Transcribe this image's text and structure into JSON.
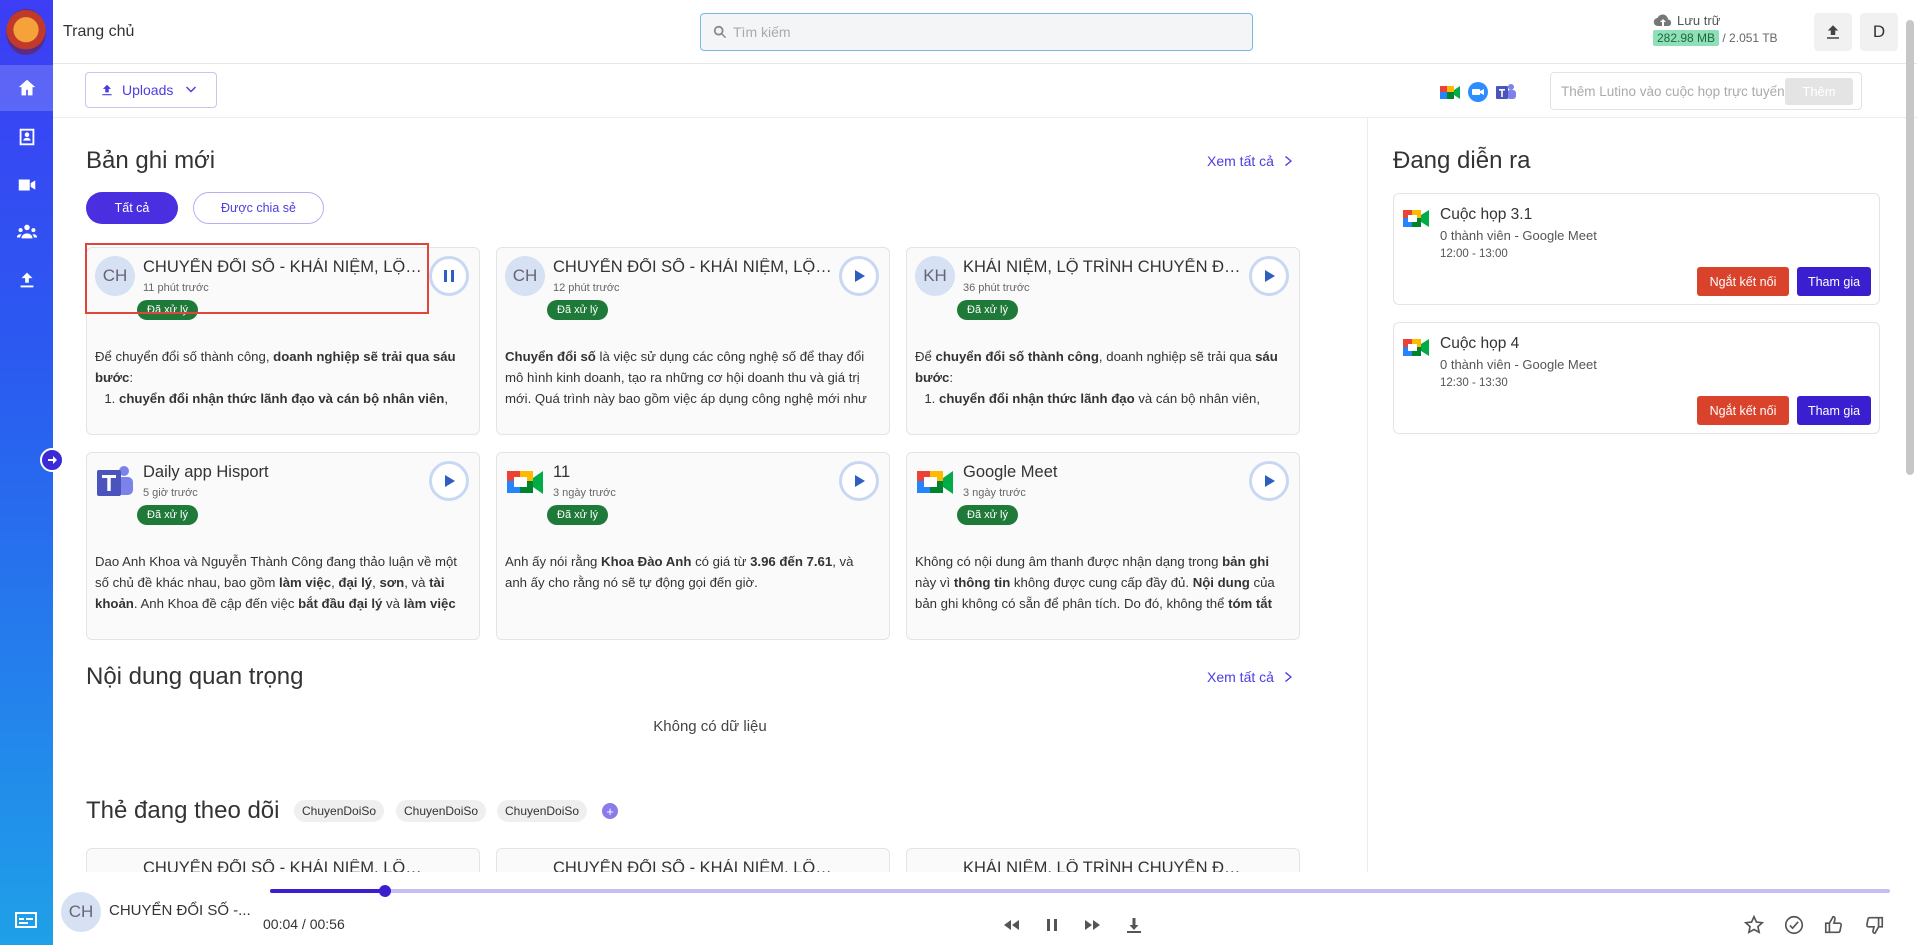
{
  "header": {
    "breadcrumb": "Trang chủ",
    "search_placeholder": "Tìm kiếm",
    "storage_label": "Lưu trữ",
    "storage_used": "282.98 MB",
    "storage_total": "/ 2.051 TB",
    "avatar_letter": "D"
  },
  "toolbar": {
    "uploads_label": "Uploads",
    "invite_placeholder": "Thêm Lutino vào cuộc họp trực tuyến",
    "invite_button": "Thêm"
  },
  "recent": {
    "title": "Bản ghi mới",
    "see_all": "Xem tất cả",
    "filter_all": "Tất cả",
    "filter_shared": "Được chia sẻ",
    "cards": [
      {
        "avatar": "CH",
        "title": "CHUYỂN ĐỔI SỐ - KHÁI NIỆM, LỘ TRÌN...",
        "time": "11 phút trước",
        "status": "Đã xử lý",
        "playing": true
      },
      {
        "avatar": "CH",
        "title": "CHUYỂN ĐỔI SỐ - KHÁI NIỆM, LỘ TRÌN...",
        "time": "12 phút trước",
        "status": "Đã xử lý",
        "playing": false
      },
      {
        "avatar": "KH",
        "title": "KHÁI NIỆM, LỘ TRÌNH CHUYỂN ĐỔI SỐ...",
        "time": "36 phút trước",
        "status": "Đã xử lý",
        "playing": false
      },
      {
        "avatar": "teams",
        "title": "Daily app Hisport",
        "time": "5 giờ trước",
        "status": "Đã xử lý",
        "playing": false
      },
      {
        "avatar": "meet",
        "title": "11",
        "time": "3 ngày trước",
        "status": "Đã xử lý",
        "playing": false
      },
      {
        "avatar": "meet",
        "title": "Google Meet",
        "time": "3 ngày trước",
        "status": "Đã xử lý",
        "playing": false
      }
    ]
  },
  "important": {
    "title": "Nội dung quan trọng",
    "see_all": "Xem tất cả",
    "empty": "Không có dữ liệu"
  },
  "tags": {
    "title": "Thẻ đang theo dõi",
    "items": [
      "ChuyenDoiSo",
      "ChuyenDoiSo",
      "ChuyenDoiSo"
    ],
    "add": "+",
    "peek_titles": [
      "CHUYỂN ĐỔI SỐ - KHÁI NIỆM, LỘ TRÌN...",
      "CHUYỂN ĐỔI SỐ - KHÁI NIỆM, LỘ TRÌN...",
      "KHÁI NIỆM, LỘ TRÌNH CHUYỂN ĐỔI SỐ..."
    ]
  },
  "live": {
    "title": "Đang diễn ra",
    "meetings": [
      {
        "name": "Cuộc họp 3.1",
        "subtitle": "0 thành viên - Google Meet",
        "time": "12:00 - 13:00",
        "disconnect": "Ngắt kết nối",
        "join": "Tham gia"
      },
      {
        "name": "Cuộc họp 4",
        "subtitle": "0 thành viên - Google Meet",
        "time": "12:30 - 13:30",
        "disconnect": "Ngắt kết nối",
        "join": "Tham gia"
      }
    ]
  },
  "player": {
    "avatar": "CH",
    "title": "CHUYỂN ĐỔI SỐ -...",
    "time": "00:04 / 00:56",
    "progress": 0.071
  },
  "colors": {
    "accent": "#3a1fd0",
    "danger": "#d9432c",
    "success": "#1f7a3a"
  }
}
